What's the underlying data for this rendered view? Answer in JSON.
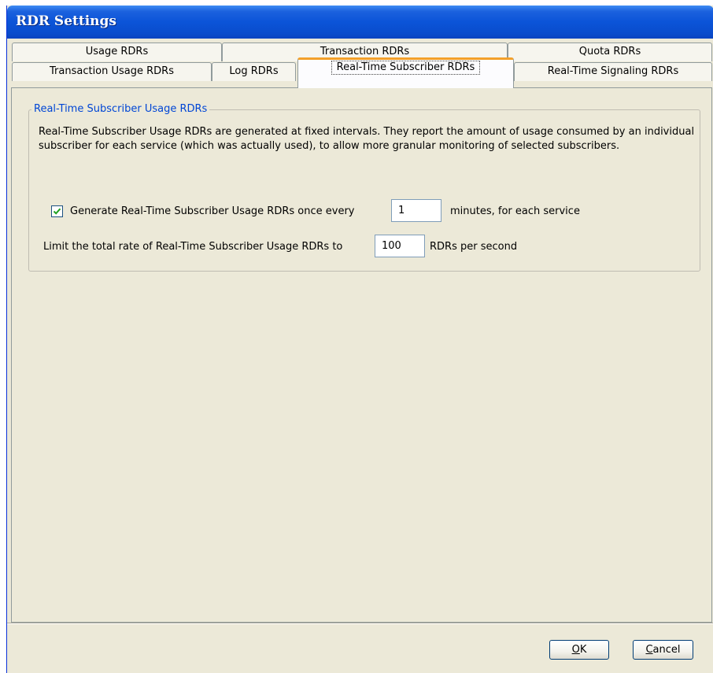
{
  "window": {
    "title": "RDR Settings"
  },
  "tabs": {
    "row1": [
      {
        "label": "Usage RDRs"
      },
      {
        "label": "Transaction RDRs"
      },
      {
        "label": "Quota RDRs"
      }
    ],
    "row2": [
      {
        "label": "Transaction Usage RDRs"
      },
      {
        "label": "Log RDRs"
      },
      {
        "label": "Real-Time Subscriber RDRs",
        "active": true
      },
      {
        "label": "Real-Time Signaling RDRs"
      }
    ]
  },
  "group": {
    "title": "Real-Time Subscriber Usage RDRs",
    "description": "Real-Time Subscriber Usage RDRs are generated at fixed intervals. They report the amount of usage consumed by an individual subscriber for each service (which was actually used), to allow more granular monitoring of selected subscribers."
  },
  "interval": {
    "checked": true,
    "label": "Generate Real-Time Subscriber Usage RDRs once every",
    "value": "1",
    "suffix": "minutes, for each service"
  },
  "limit": {
    "label": "Limit the total rate of Real-Time Subscriber Usage RDRs to",
    "value": "100",
    "suffix": "RDRs per second"
  },
  "buttons": {
    "ok": {
      "mnemonic": "O",
      "rest": "K"
    },
    "cancel": {
      "mnemonic": "C",
      "rest": "ancel"
    }
  },
  "colors": {
    "titlebar": "#0a4ccc",
    "dialog_bg": "#ece9d8",
    "group_title": "#0046d5",
    "active_tab_highlight": "#f3a02a",
    "checkmark": "#21a121"
  }
}
